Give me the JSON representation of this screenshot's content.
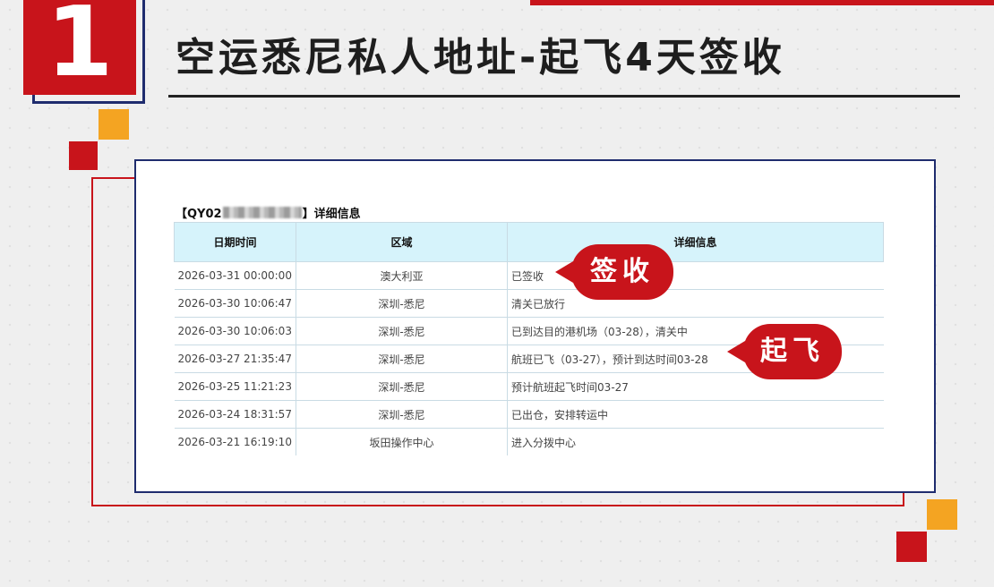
{
  "badge_number": "1",
  "title": "空运悉尼私人地址-起飞4天签收",
  "detail": {
    "prefix": "【QY02",
    "suffix": "】详细信息"
  },
  "table": {
    "headers": [
      "日期时间",
      "区域",
      "详细信息"
    ],
    "rows": [
      {
        "time": "2026-03-31 00:00:00",
        "area": "澳大利亚",
        "info": "已签收"
      },
      {
        "time": "2026-03-30 10:06:47",
        "area": "深圳-悉尼",
        "info": "清关已放行"
      },
      {
        "time": "2026-03-30 10:06:03",
        "area": "深圳-悉尼",
        "info": "已到达目的港机场（03-28），清关中"
      },
      {
        "time": "2026-03-27 21:35:47",
        "area": "深圳-悉尼",
        "info": "航班已飞（03-27），预计到达时间03-28"
      },
      {
        "time": "2026-03-25 11:21:23",
        "area": "深圳-悉尼",
        "info": "预计航班起飞时间03-27"
      },
      {
        "time": "2026-03-24 18:31:57",
        "area": "深圳-悉尼",
        "info": "已出仓，安排转运中"
      },
      {
        "time": "2026-03-21 16:19:10",
        "area": "坂田操作中心",
        "info": "进入分拨中心"
      }
    ]
  },
  "callouts": {
    "signed": "签收",
    "takeoff": "起飞"
  },
  "colors": {
    "accent_red": "#c8141b",
    "navy": "#1f2c6e",
    "yellow": "#f4a422",
    "header_bg": "#d6f3fb"
  }
}
